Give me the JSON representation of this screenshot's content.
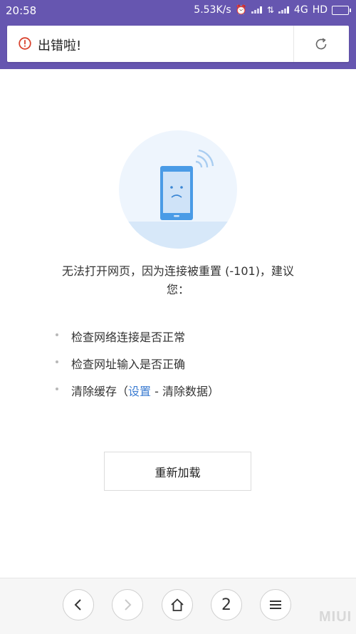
{
  "status_bar": {
    "time": "20:58",
    "speed": "5.53K/s",
    "network": "4G",
    "hd": "HD"
  },
  "url_bar": {
    "title": "出错啦!",
    "error_icon": "alert-circle-icon",
    "refresh_icon": "refresh-icon"
  },
  "content": {
    "illustration_icon": "sad-phone-icon",
    "message": "无法打开网页，因为连接被重置 (-101)，建议您：",
    "tips": [
      {
        "text": "检查网络连接是否正常"
      },
      {
        "text": "检查网址输入是否正确"
      },
      {
        "pre": "清除缓存（",
        "link": "设置",
        "post": " - 清除数据）"
      }
    ],
    "reload_label": "重新加载"
  },
  "toolbar": {
    "back_icon": "chevron-left-icon",
    "forward_icon": "chevron-right-icon",
    "home_icon": "home-icon",
    "tab_count": "2",
    "menu_icon": "menu-icon"
  },
  "watermark": "MIUI",
  "colors": {
    "header": "#6656b0",
    "error_red": "#d9432f",
    "link": "#3d7dd2",
    "phone_blue": "#4a9be6"
  }
}
